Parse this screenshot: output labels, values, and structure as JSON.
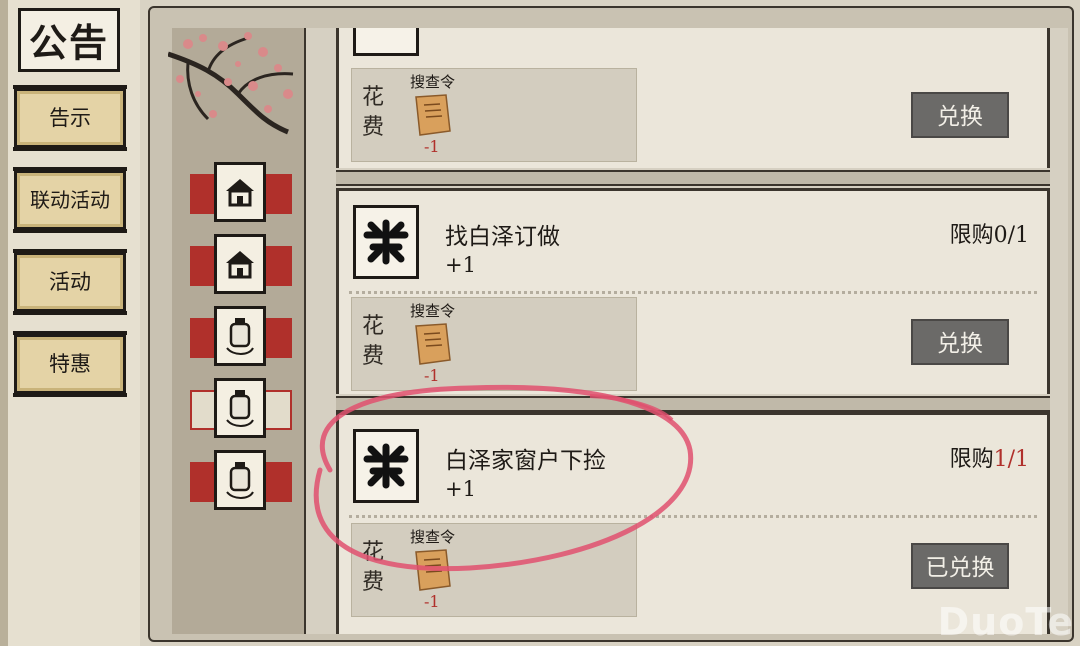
{
  "sidebar": {
    "title": "公告",
    "items": [
      {
        "label": "告示"
      },
      {
        "label": "联动活动"
      },
      {
        "label": "活动"
      },
      {
        "label": "特惠"
      }
    ]
  },
  "categories": [
    {
      "icon": "house-icon",
      "selected": false
    },
    {
      "icon": "house-icon",
      "selected": false
    },
    {
      "icon": "bottle-icon",
      "selected": false
    },
    {
      "icon": "bottle-icon",
      "selected": true
    },
    {
      "icon": "bottle-icon",
      "selected": false
    }
  ],
  "shop": {
    "cost_label": "花费",
    "items": [
      {
        "cost_item": "搜查令",
        "cost_qty": "-1",
        "button": "兑换"
      },
      {
        "reward_icon": "clue-icon",
        "name": "找白泽订做",
        "gain": "+1",
        "limit_label": "限购",
        "limit_count": "0/1",
        "cost_item": "搜查令",
        "cost_qty": "-1",
        "button": "兑换"
      },
      {
        "reward_icon": "clue-icon",
        "name": "白泽家窗户下捡",
        "gain": "+1",
        "limit_label": "限购",
        "limit_count": "1/1",
        "cost_item": "搜查令",
        "cost_qty": "-1",
        "button": "已兑换"
      }
    ]
  },
  "colors": {
    "accent_red": "#b0302b",
    "button_gray": "#6b6a68"
  },
  "watermark": "DuoTe"
}
